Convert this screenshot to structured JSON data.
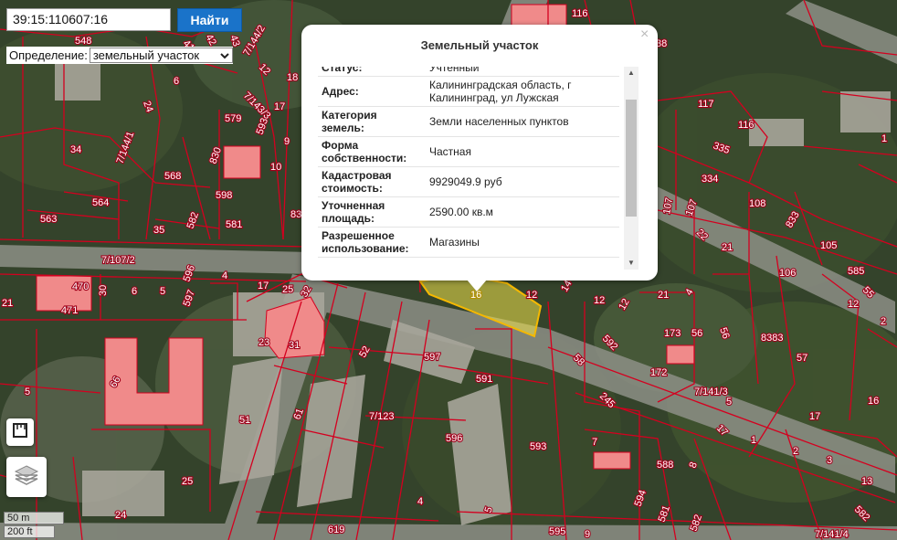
{
  "search": {
    "value": "39:15:110607:16",
    "button_label": "Найти"
  },
  "definition": {
    "label": "Определение:",
    "selected": "земельный участок"
  },
  "popup": {
    "title": "Земельный участок",
    "close_symbol": "×",
    "rows": [
      {
        "key": "Статус:",
        "value": "Учтенный"
      },
      {
        "key": "Адрес:",
        "value": "Калининградская область, г Калининград, ул Лужская"
      },
      {
        "key": "Категория земель:",
        "value": "Земли населенных пунктов"
      },
      {
        "key": "Форма собственности:",
        "value": "Частная"
      },
      {
        "key": "Кадастровая стоимость:",
        "value": "9929049.9 руб"
      },
      {
        "key": "Уточненная площадь:",
        "value": "2590.00 кв.м"
      },
      {
        "key": "Разрешенное использование:",
        "value": "Магазины"
      }
    ]
  },
  "highlighted_parcel_label": "16",
  "scale": {
    "metric": "50 m",
    "imperial": "200 ft"
  },
  "colors": {
    "boundary": "#d4001f",
    "highlight_fill": "#f2e34a",
    "highlight_border": "#f5b800",
    "building_fill": "#f08a8a",
    "button": "#1a73c9"
  },
  "icons": {
    "ruler": "ruler-icon",
    "layers": "layers-icon"
  },
  "map_labels": [
    "548",
    "41",
    "42",
    "43",
    "116",
    "38",
    "6",
    "12",
    "18",
    "7/144/2",
    "24",
    "7/143/3",
    "17",
    "579",
    "593",
    "9",
    "117",
    "116",
    "34",
    "7/144/1",
    "568",
    "830",
    "10",
    "335",
    "1",
    "334",
    "598",
    "108",
    "564",
    "563",
    "35",
    "582",
    "581",
    "83",
    "107",
    "107",
    "22",
    "833",
    "105",
    "21",
    "106",
    "7/107/2",
    "470",
    "471",
    "21",
    "30",
    "6",
    "5",
    "596",
    "597",
    "4",
    "17",
    "25",
    "32",
    "12",
    "14",
    "12",
    "12",
    "21",
    "4",
    "55",
    "12",
    "2",
    "23",
    "31",
    "52",
    "597",
    "591",
    "592",
    "173",
    "56",
    "56",
    "8383",
    "57",
    "58",
    "172",
    "5",
    "66",
    "245",
    "7/141/3",
    "5",
    "16",
    "51",
    "61",
    "7/123",
    "596",
    "593",
    "7",
    "17",
    "17",
    "1",
    "2",
    "3",
    "25",
    "4",
    "594",
    "588",
    "8",
    "13",
    "24",
    "5",
    "619",
    "595",
    "9",
    "581",
    "582",
    "582",
    "7/141/4",
    "585",
    "53",
    "2"
  ]
}
